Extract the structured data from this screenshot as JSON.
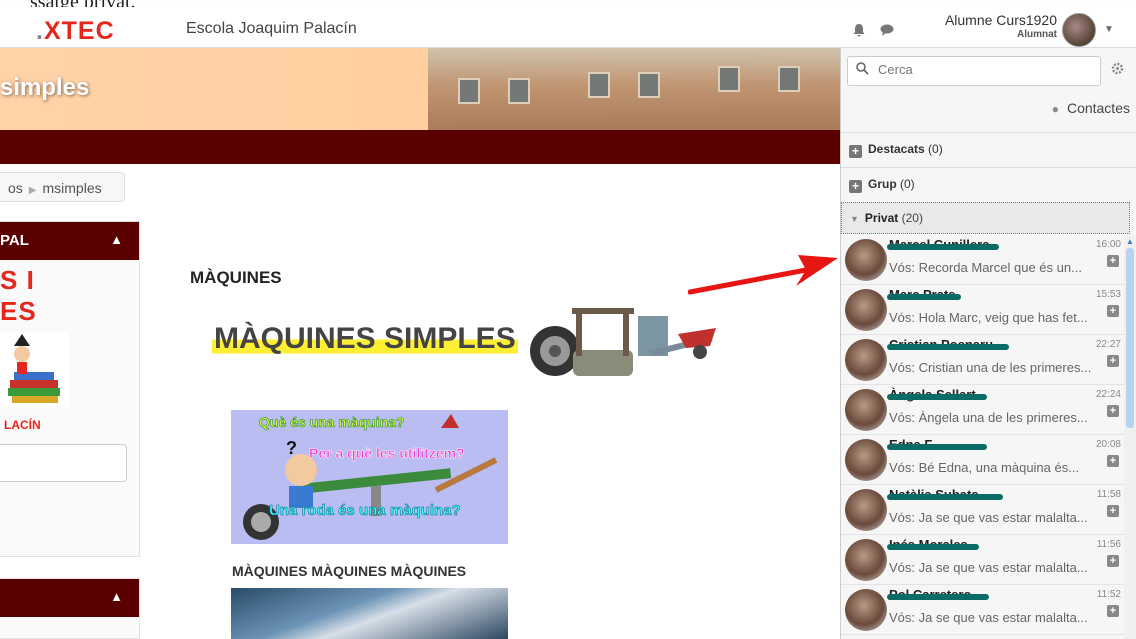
{
  "caption": "ssatge privat.",
  "navbar": {
    "logo_dot": ".",
    "logo_name": "XTEC",
    "school": "Escola Joaquim Palacín",
    "user_name": "Alumne Curs1920",
    "user_role": "Alumnat"
  },
  "banner": {
    "title": "simples"
  },
  "breadcrumb": {
    "prev": "os",
    "current": "msimples"
  },
  "left": {
    "block1_title": "PAL",
    "big_line1": "S I",
    "big_line2": "ES",
    "school_short": "LACÍN"
  },
  "main": {
    "heading": "MÀQUINES",
    "simples_title": "MÀQUINES SIMPLES",
    "quiz_q1": "Què és una màquina?",
    "quiz_q2": "Per a què les utilitzem?",
    "quiz_q3": "Una roda és una màquina?",
    "repeat_title": "MÀQUINES MÀQUINES MÀQUINES"
  },
  "sidebar": {
    "search_placeholder": "Cerca",
    "contacts_label": "Contactes",
    "groups": [
      {
        "label": "Destacats",
        "count": "(0)"
      },
      {
        "label": "Grup",
        "count": "(0)"
      }
    ],
    "privat": {
      "label": "Privat",
      "count": "(20)"
    },
    "chats": [
      {
        "name": "Marcel Cunillera",
        "time": "16:00",
        "message": "Vós: Recorda Marcel que és un..."
      },
      {
        "name": "Marc Prats",
        "time": "15:53",
        "message": "Vós: Hola Marc, veig que has fet..."
      },
      {
        "name": "Cristian Poenaru",
        "time": "22:27",
        "message": "Vós: Cristian una de les primeres..."
      },
      {
        "name": "Àngela Sellart",
        "time": "22:24",
        "message": "Vós: Àngela una de les primeres..."
      },
      {
        "name": "Edna F.",
        "time": "20:08",
        "message": "Vós: Bé Edna, una màquina és..."
      },
      {
        "name": "Natàlia Subats",
        "time": "11:58",
        "message": "Vós: Ja se que vas estar malalta..."
      },
      {
        "name": "Inés Morales",
        "time": "11:56",
        "message": "Vós: Ja se que vas estar malalta..."
      },
      {
        "name": "Pol Carretero",
        "time": "11:52",
        "message": "Vós: Ja se que vas estar malalta..."
      }
    ]
  },
  "colors": {
    "accent": "#5a0000",
    "brand_red": "#e4261c",
    "annotation_arrow": "#e81515"
  }
}
